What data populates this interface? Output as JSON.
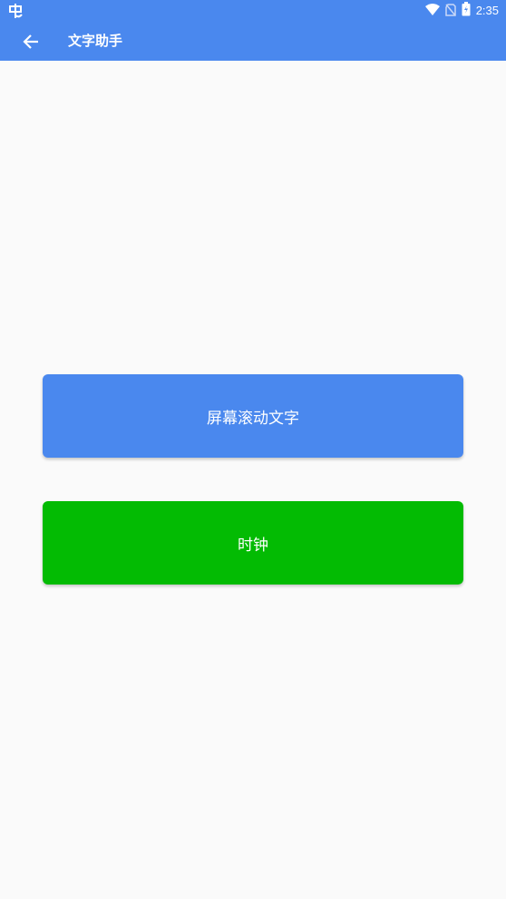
{
  "status_bar": {
    "time": "2:35",
    "icons": [
      "bug-icon",
      "wifi-icon",
      "no-sim-icon",
      "battery-charging-icon"
    ]
  },
  "toolbar": {
    "title": "文字助手",
    "back_icon": "arrow-back-icon"
  },
  "buttons": [
    {
      "label": "屏幕滚动文字",
      "color": "#4a88ee"
    },
    {
      "label": "时钟",
      "color": "#03bb03"
    }
  ],
  "colors": {
    "primary": "#4a88ee",
    "background": "#fafafa",
    "clock_button": "#03bb03",
    "on_primary": "#ffffff"
  }
}
